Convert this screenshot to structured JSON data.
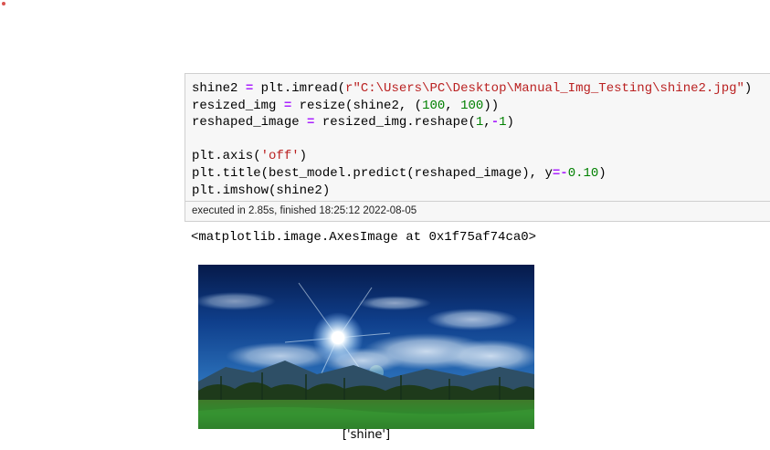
{
  "code_cell": {
    "lines": [
      [
        {
          "t": "shine2 "
        },
        {
          "t": "=",
          "c": "op"
        },
        {
          "t": " plt.imread("
        },
        {
          "t": "r\"C:\\Users\\PC\\Desktop\\Manual_Img_Testing\\shine2.jpg\"",
          "c": "str"
        },
        {
          "t": ")"
        }
      ],
      [
        {
          "t": "resized_img "
        },
        {
          "t": "=",
          "c": "op"
        },
        {
          "t": " resize(shine2, ("
        },
        {
          "t": "100",
          "c": "num"
        },
        {
          "t": ", "
        },
        {
          "t": "100",
          "c": "num"
        },
        {
          "t": "))"
        }
      ],
      [
        {
          "t": "reshaped_image "
        },
        {
          "t": "=",
          "c": "op"
        },
        {
          "t": " resized_img.reshape("
        },
        {
          "t": "1",
          "c": "num"
        },
        {
          "t": ","
        },
        {
          "t": "-",
          "c": "op"
        },
        {
          "t": "1",
          "c": "num"
        },
        {
          "t": ")"
        }
      ],
      [],
      [
        {
          "t": "plt.axis("
        },
        {
          "t": "'off'",
          "c": "str"
        },
        {
          "t": ")"
        }
      ],
      [
        {
          "t": "plt.title(best_model.predict(reshaped_image), y"
        },
        {
          "t": "=-",
          "c": "op"
        },
        {
          "t": "0.10",
          "c": "num"
        },
        {
          "t": ")"
        }
      ],
      [
        {
          "t": "plt.imshow(shine2)"
        }
      ]
    ]
  },
  "execution": {
    "status_text": "executed in 2.85s, finished 18:25:12 2022-08-05"
  },
  "output": {
    "repr_text": "<matplotlib.image.AxesImage at 0x1f75af74ca0>",
    "plot_title": "['shine']"
  },
  "colors": {
    "operator": "#aa22ff",
    "string": "#ba2121",
    "number": "#008000",
    "cell_background": "#f7f7f7",
    "cell_border": "#cfcfcf"
  }
}
